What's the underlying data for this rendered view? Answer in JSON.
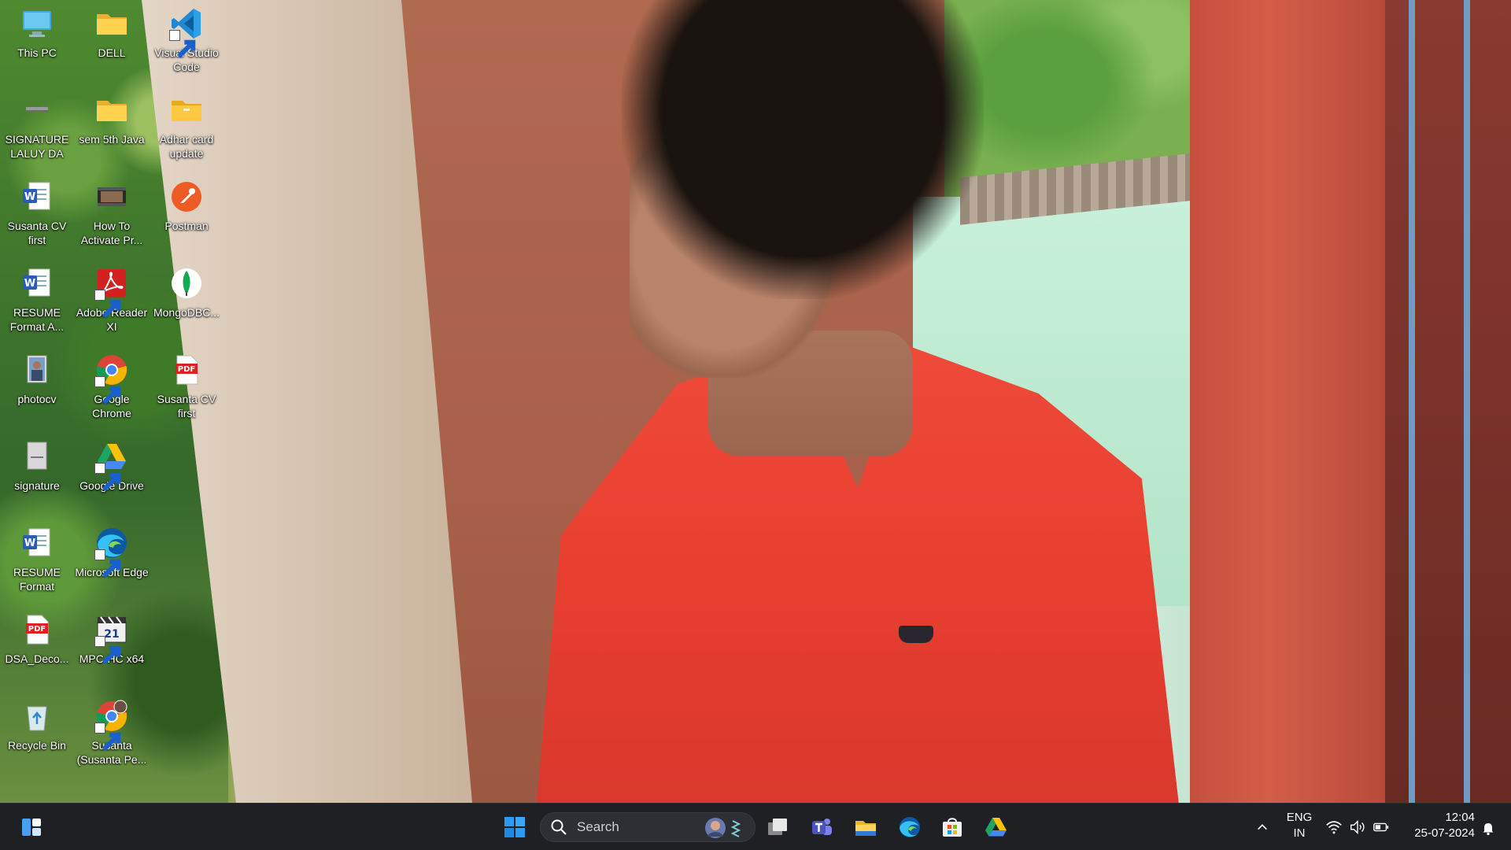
{
  "desktop": {
    "icons": [
      {
        "label": "This PC",
        "icon": "monitor-icon"
      },
      {
        "label": "DELL",
        "icon": "folder-icon"
      },
      {
        "label": "Visual Studio Code",
        "icon": "vscode-icon"
      },
      {
        "label": "SIGNATURE LALUY DA",
        "icon": "image-file-icon"
      },
      {
        "label": "sem 5th Java",
        "icon": "folder-icon"
      },
      {
        "label": "Adhar card update",
        "icon": "folder-icon"
      },
      {
        "label": "Susanta CV first",
        "icon": "word-doc-icon"
      },
      {
        "label": "How To Activate Pr...",
        "icon": "video-file-icon"
      },
      {
        "label": "Postman",
        "icon": "postman-icon"
      },
      {
        "label": "RESUME Format A...",
        "icon": "word-doc-icon"
      },
      {
        "label": "Adobe Reader XI",
        "icon": "acrobat-icon"
      },
      {
        "label": "MongoDBC...",
        "icon": "mongodb-icon"
      },
      {
        "label": "photocv",
        "icon": "photo-file-icon"
      },
      {
        "label": "Google Chrome",
        "icon": "chrome-icon"
      },
      {
        "label": "Susanta CV first",
        "icon": "pdf-icon"
      },
      {
        "label": "signature",
        "icon": "image-file-icon"
      },
      {
        "label": "Google Drive",
        "icon": "google-drive-icon"
      },
      {
        "label": "RESUME Format",
        "icon": "word-doc-icon"
      },
      {
        "label": "Microsoft Edge",
        "icon": "edge-icon"
      },
      {
        "label": "DSA_Deco...",
        "icon": "pdf-icon"
      },
      {
        "label": "MPC-HC x64",
        "icon": "mpc-hc-icon"
      },
      {
        "label": "Recycle Bin",
        "icon": "recycle-bin-icon"
      },
      {
        "label": "Susanta (Susanta Pe...",
        "icon": "chrome-profile-icon"
      }
    ]
  },
  "taskbar": {
    "search_placeholder": "Search",
    "pinned": [
      "task-view",
      "teams",
      "file-explorer",
      "edge",
      "microsoft-store",
      "google-drive"
    ],
    "language_top": "ENG",
    "language_bottom": "IN",
    "time": "12:04",
    "date": "25-07-2024"
  },
  "colors": {
    "taskbar_bg": "#1f2024",
    "accent": "#0078d4",
    "shirt": "#e8402f"
  }
}
